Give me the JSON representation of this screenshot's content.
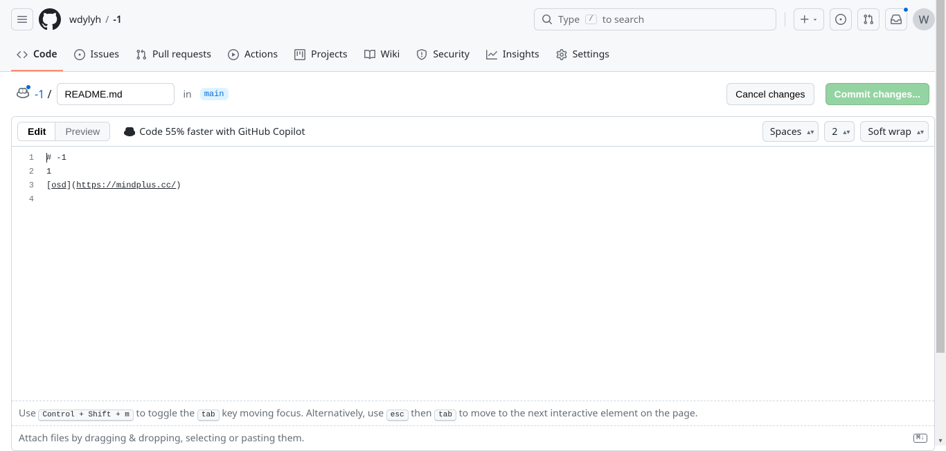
{
  "header": {
    "owner": "wdylyh",
    "repo": "-1",
    "search_prefix": "Type ",
    "search_suffix": " to search",
    "search_key": "/",
    "avatar_initial": "W"
  },
  "nav": {
    "items": [
      {
        "label": "Code"
      },
      {
        "label": "Issues"
      },
      {
        "label": "Pull requests"
      },
      {
        "label": "Actions"
      },
      {
        "label": "Projects"
      },
      {
        "label": "Wiki"
      },
      {
        "label": "Security"
      },
      {
        "label": "Insights"
      },
      {
        "label": "Settings"
      }
    ]
  },
  "subheader": {
    "root": "-1",
    "filename": "README.md",
    "in_label": "in",
    "branch": "main",
    "cancel": "Cancel changes",
    "commit": "Commit changes..."
  },
  "editor": {
    "tab_edit": "Edit",
    "tab_preview": "Preview",
    "copilot_promo": "Code 55% faster with GitHub Copilot",
    "indent_mode": "Spaces",
    "indent_size": "2",
    "wrap_mode": "Soft wrap",
    "lines": [
      "# -1",
      "1",
      "[osd](https://mindplus.cc/)",
      ""
    ],
    "hint_prefix": "Use ",
    "hint_kbd1": "Control + Shift + m",
    "hint_mid1": " to toggle the ",
    "hint_kbd2": "tab",
    "hint_mid2": " key moving focus. Alternatively, use ",
    "hint_kbd3": "esc",
    "hint_mid3": " then ",
    "hint_kbd4": "tab",
    "hint_suffix": " to move to the next interactive element on the page.",
    "attach_hint": "Attach files by dragging & dropping, selecting or pasting them."
  }
}
